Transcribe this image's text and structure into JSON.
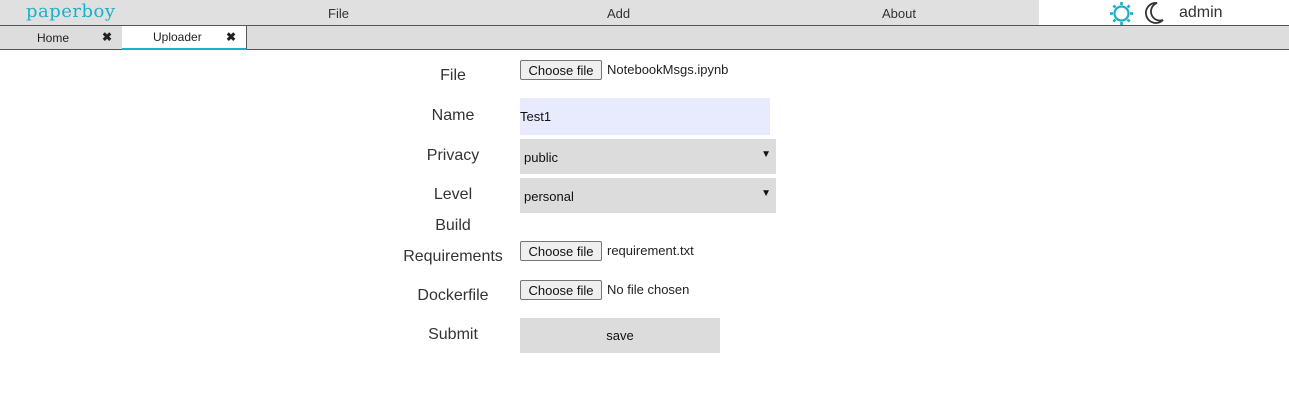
{
  "app": {
    "brand": "paperboy",
    "accent_color": "#1ab0c8"
  },
  "menu": {
    "file": "File",
    "add": "Add",
    "about": "About"
  },
  "user": {
    "name": "admin",
    "theme_light_icon": "sun-icon",
    "theme_dark_icon": "moon-icon"
  },
  "tabs": [
    {
      "label": "Home",
      "close": "✖",
      "active": false
    },
    {
      "label": "Uploader",
      "close": "✖",
      "active": true
    }
  ],
  "form": {
    "file_label": "File",
    "file_button": "Choose file",
    "file_value": "NotebookMsgs.ipynb",
    "name_label": "Name",
    "name_value": "Test1",
    "privacy_label": "Privacy",
    "privacy_value": "public",
    "level_label": "Level",
    "level_value": "personal",
    "build_label": "Build",
    "requirements_label": "Requirements",
    "requirements_button": "Choose file",
    "requirements_value": "requirement.txt",
    "dockerfile_label": "Dockerfile",
    "dockerfile_button": "Choose file",
    "dockerfile_value": "No file chosen",
    "submit_label": "Submit",
    "save_button": "save",
    "dropdown_arrow": "▼"
  }
}
